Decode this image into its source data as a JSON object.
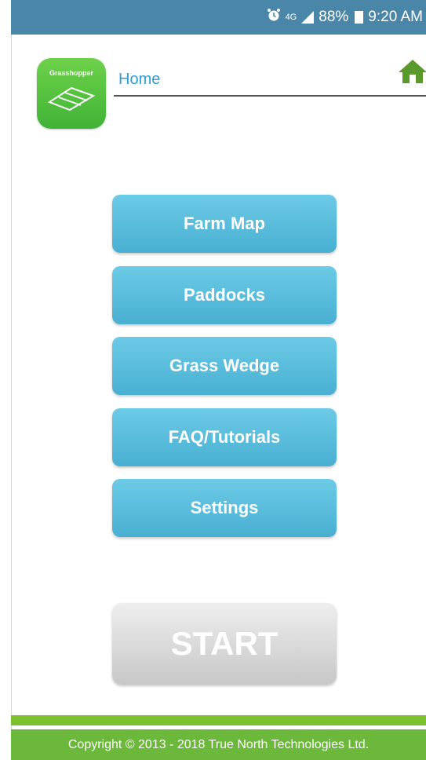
{
  "status_bar": {
    "network": "4G",
    "battery": "88%",
    "time": "9:20 AM",
    "icons": [
      "alarm-icon",
      "signal-icon",
      "battery-icon"
    ]
  },
  "header": {
    "logo_text": "Grasshopper",
    "title": "Home"
  },
  "menu": {
    "items": [
      {
        "label": "Farm Map"
      },
      {
        "label": "Paddocks"
      },
      {
        "label": "Grass Wedge"
      },
      {
        "label": "FAQ/Tutorials"
      },
      {
        "label": "Settings"
      }
    ]
  },
  "start_label": "START",
  "footer": {
    "copyright": "Copyright © 2013 - 2018 True North Technologies Ltd."
  },
  "colors": {
    "status_bar": "#4a86a8",
    "menu_button": "#5bbfdf",
    "start_button": "#d4d4d4",
    "footer": "#6bb83a",
    "title": "#2e9ed6"
  }
}
